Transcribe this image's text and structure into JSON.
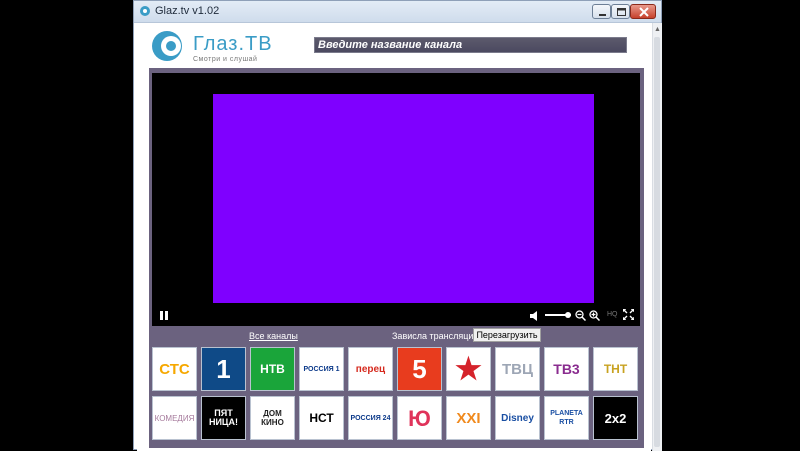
{
  "window": {
    "title": "Glaz.tv v1.02"
  },
  "logo": {
    "name": "Глаз.ТВ",
    "tagline": "Смотри и слушай"
  },
  "search": {
    "placeholder": "Введите название канала",
    "value": ""
  },
  "player": {
    "hq_label": "HQ",
    "volume_level": 0.75
  },
  "links": {
    "all_channels": "Все каналы"
  },
  "status": {
    "freeze_question": "Зависла трансляция?",
    "reload_label": "Перезагрузить"
  },
  "colors": {
    "accent": "#3a9cc6",
    "video_placeholder": "#7f00ff",
    "stage_bg": "#6b627f"
  },
  "channels": [
    {
      "label": "СТС",
      "bg": "#ffffff",
      "fg": "#f6a800",
      "size": "15px",
      "weight": "bold"
    },
    {
      "label": "1",
      "bg": "#0f4a87",
      "fg": "#ffffff",
      "size": "26px",
      "weight": "bold"
    },
    {
      "label": "НТВ",
      "bg": "#1aa53a",
      "fg": "#ffffff",
      "size": "12px",
      "weight": "bold"
    },
    {
      "label": "РОССИЯ 1",
      "bg": "#ffffff",
      "fg": "#0c3a8a",
      "size": "7px",
      "weight": "bold"
    },
    {
      "label": "перец",
      "bg": "#ffffff",
      "fg": "#d62a1e",
      "size": "10px",
      "weight": "bold"
    },
    {
      "label": "5",
      "bg": "#e83c1e",
      "fg": "#ffffff",
      "size": "26px",
      "weight": "bold"
    },
    {
      "label": "★",
      "bg": "#ffffff",
      "fg": "#d5232b",
      "size": "30px",
      "weight": "bold"
    },
    {
      "label": "ТВЦ",
      "bg": "#ffffff",
      "fg": "#9da6b5",
      "size": "15px",
      "weight": "bold"
    },
    {
      "label": "ТВ3",
      "bg": "#ffffff",
      "fg": "#8a2c8f",
      "size": "14px",
      "weight": "bold"
    },
    {
      "label": "ТНТ",
      "bg": "#ffffff",
      "fg": "#c8a220",
      "size": "12px",
      "weight": "bold"
    },
    {
      "label": "КОМЕДИЯ",
      "bg": "#ffffff",
      "fg": "#a67a9c",
      "size": "8px",
      "weight": "normal"
    },
    {
      "label": "ПЯТ НИЦА!",
      "bg": "#000000",
      "fg": "#ffffff",
      "size": "9px",
      "weight": "bold"
    },
    {
      "label": "ДОМ КИНО",
      "bg": "#ffffff",
      "fg": "#222222",
      "size": "8px",
      "weight": "bold"
    },
    {
      "label": "НСТ",
      "bg": "#ffffff",
      "fg": "#000000",
      "size": "12px",
      "weight": "bold"
    },
    {
      "label": "РОССИЯ 24",
      "bg": "#ffffff",
      "fg": "#0c3a8a",
      "size": "7px",
      "weight": "bold"
    },
    {
      "label": "Ю",
      "bg": "#ffffff",
      "fg": "#e0335a",
      "size": "22px",
      "weight": "bold"
    },
    {
      "label": "XXI",
      "bg": "#ffffff",
      "fg": "#f08a1e",
      "size": "15px",
      "weight": "bold"
    },
    {
      "label": "Disney",
      "bg": "#ffffff",
      "fg": "#1a4fa3",
      "size": "10px",
      "weight": "bold"
    },
    {
      "label": "PLANETA RTR",
      "bg": "#ffffff",
      "fg": "#1a4fa3",
      "size": "7px",
      "weight": "bold"
    },
    {
      "label": "2x2",
      "bg": "#000000",
      "fg": "#ffffff",
      "size": "13px",
      "weight": "bold"
    }
  ]
}
